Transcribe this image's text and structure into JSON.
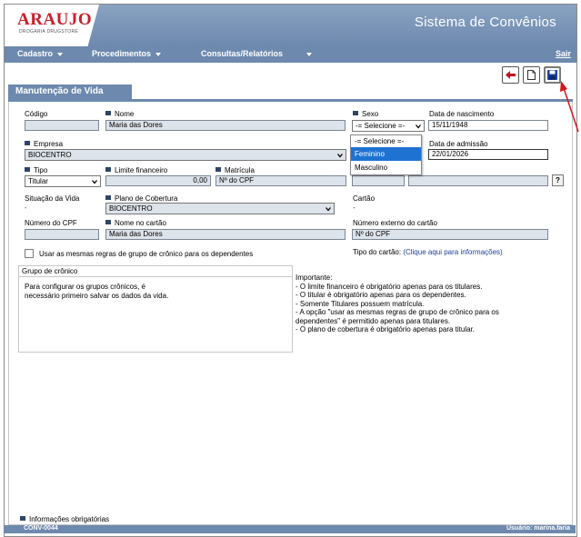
{
  "header": {
    "logo_text": "ARAUJO",
    "logo_sub": "DROGARIA  DRUGSTORE",
    "app_title": "Sistema de Convênios"
  },
  "nav": {
    "items": [
      {
        "label": "Cadastro"
      },
      {
        "label": "Procedimentos"
      },
      {
        "label": "Consultas/Relatórios"
      }
    ],
    "logout": "Sair"
  },
  "section": {
    "title": "Manutenção de Vida"
  },
  "form": {
    "codigo": {
      "label": "Código",
      "value": ""
    },
    "nome": {
      "label": "Nome",
      "value": "Maria das Dores"
    },
    "sexo": {
      "label": "Sexo",
      "value": "-= Selecione =-",
      "options": [
        "-= Selecione =-",
        "Feminino",
        "Masculino"
      ],
      "highlighted": "Feminino"
    },
    "nascimento": {
      "label": "Data de nascimento",
      "value": "15/11/1948"
    },
    "empresa": {
      "label": "Empresa",
      "value": "BIOCENTRO"
    },
    "admissao": {
      "label": "Data de admissão",
      "value": "22/01/2026"
    },
    "tipo": {
      "label": "Tipo",
      "value": "Titular"
    },
    "limite": {
      "label": "Limite financeiro",
      "value": "0,00"
    },
    "matricula": {
      "label": "Matrícula",
      "value": "Nº do CPF"
    },
    "help": "?",
    "situacao": {
      "label": "Situação da Vida",
      "value": "-"
    },
    "plano": {
      "label": "Plano de Cobertura",
      "value": "BIOCENTRO"
    },
    "cartao": {
      "label": "Cartão",
      "value": "-"
    },
    "cpf": {
      "label": "Número do CPF",
      "value": ""
    },
    "nome_cartao": {
      "label": "Nome no cartão",
      "value": "Maria das Dores"
    },
    "externo": {
      "label": "Número externo do cartão",
      "value": "Nº do CPF"
    },
    "regras_label": "Usar as mesmas regras de grupo de crônico para os dependentes",
    "tipo_cartao_label": "Tipo do cartão:",
    "tipo_cartao_link": "(Clique aqui para informações)"
  },
  "cronico": {
    "title": "Grupo de crônico",
    "text_line1": "Para configurar os grupos crônicos, é",
    "text_line2": "necessário primeiro salvar os dados da vida."
  },
  "notes": [
    "Importante:",
    "- O limite financeiro é obrigatório apenas para os titulares.",
    "- O titular é obrigatório apenas para os dependentes.",
    "- Somente Titulares possuem matrícula.",
    "- A opção \"usar as mesmas regras de grupo de crônico para os",
    "dependentes\" é permitido apenas para titulares.",
    "- O plano de cobertura é obrigatório apenas para titular."
  ],
  "footer": {
    "legend": "Informações obrigatórias",
    "code": "CONV-0044",
    "user": "Usuário: marina.faria"
  },
  "colors": {
    "header": "#6d89ae",
    "required": "#2f4467",
    "dropdown_highlight": "#1e73d2",
    "logo": "#c8202a",
    "arrow": "#d8141b"
  },
  "icons": {
    "back": "arrow-left-icon",
    "new": "new-document-icon",
    "save": "floppy-disk-icon"
  }
}
